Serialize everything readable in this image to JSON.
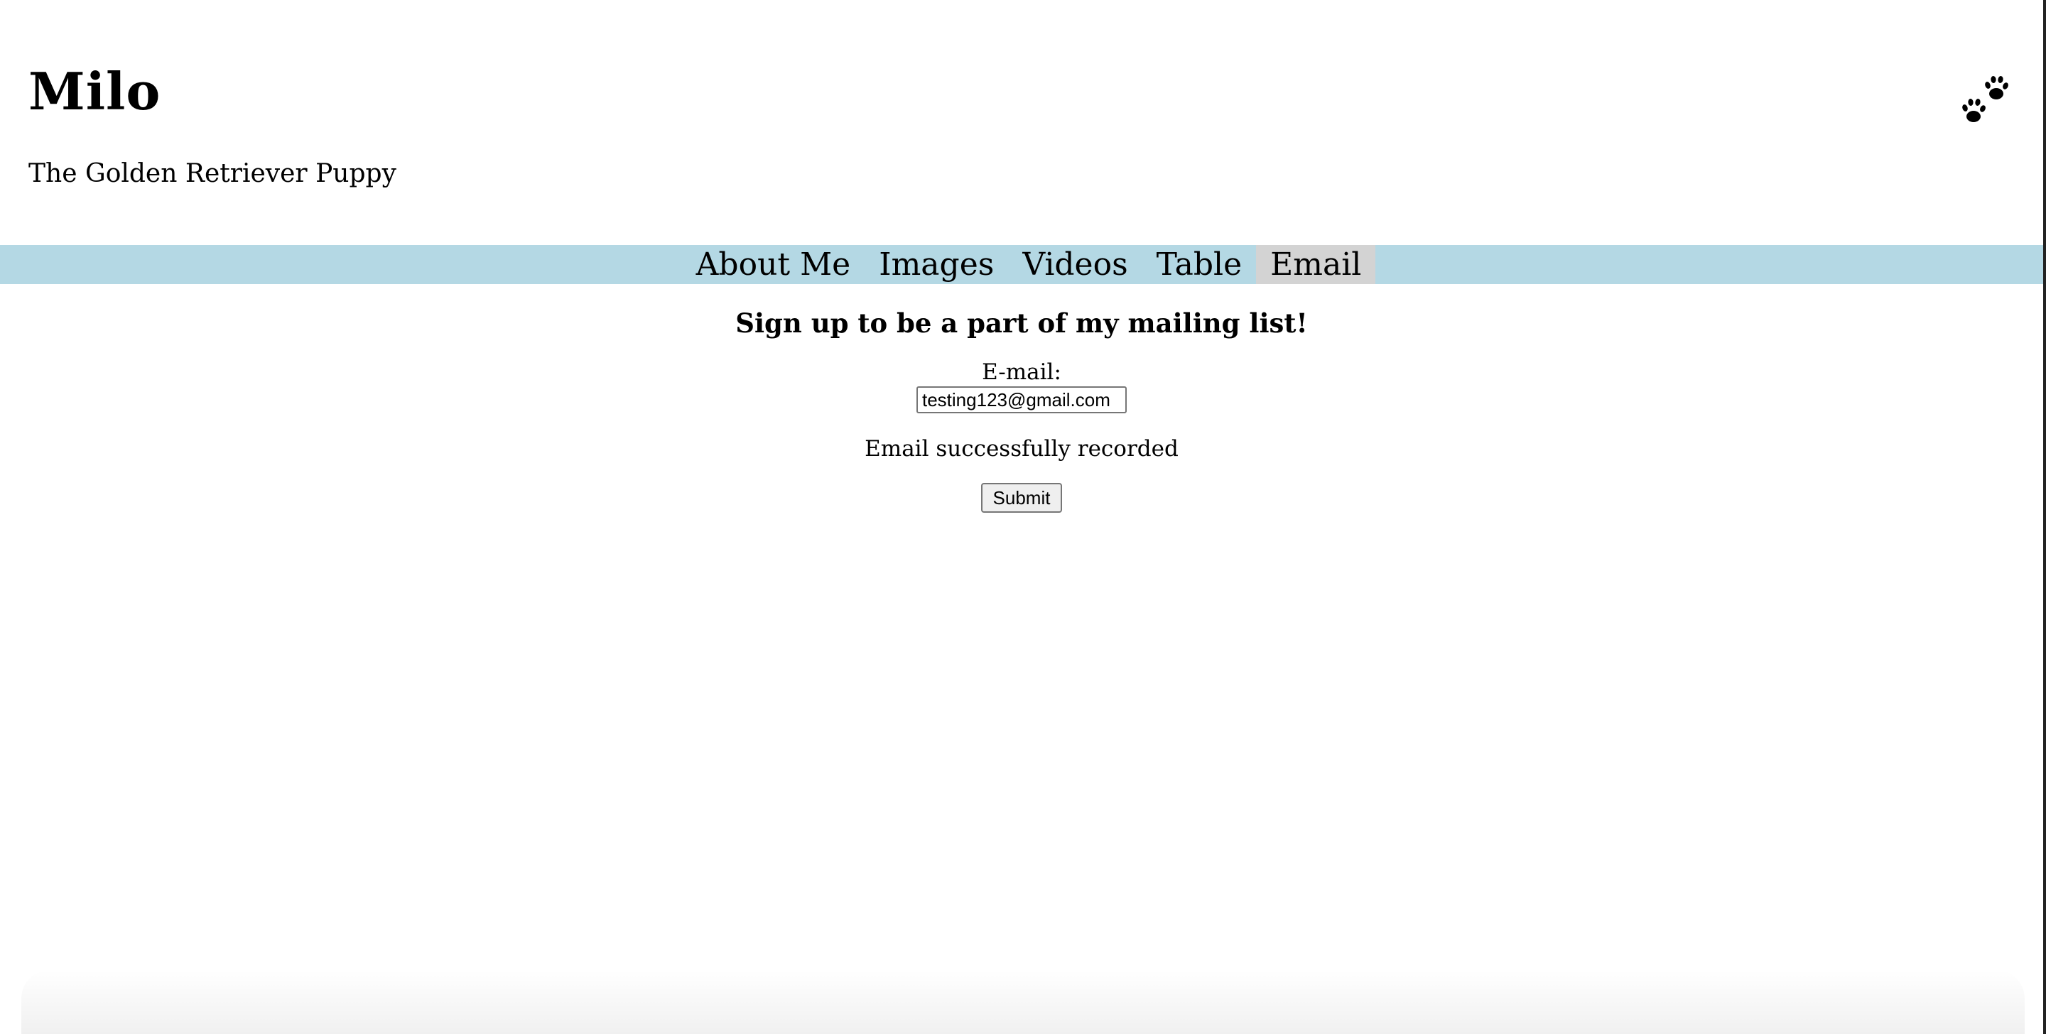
{
  "header": {
    "title": "Milo",
    "subtitle": "The Golden Retriever Puppy",
    "logo_icon": "paw-prints-icon"
  },
  "nav": {
    "items": [
      {
        "label": "About Me",
        "active": false
      },
      {
        "label": "Images",
        "active": false
      },
      {
        "label": "Videos",
        "active": false
      },
      {
        "label": "Table",
        "active": false
      },
      {
        "label": "Email",
        "active": true
      }
    ],
    "bar_color": "#b4d8e4",
    "active_color": "#d3d3d3"
  },
  "form": {
    "heading": "Sign up to be a part of my mailing list!",
    "email_label": "E-mail:",
    "email_value": "testing123@gmail.com",
    "status_message": "Email successfully recorded",
    "submit_label": "Submit"
  }
}
